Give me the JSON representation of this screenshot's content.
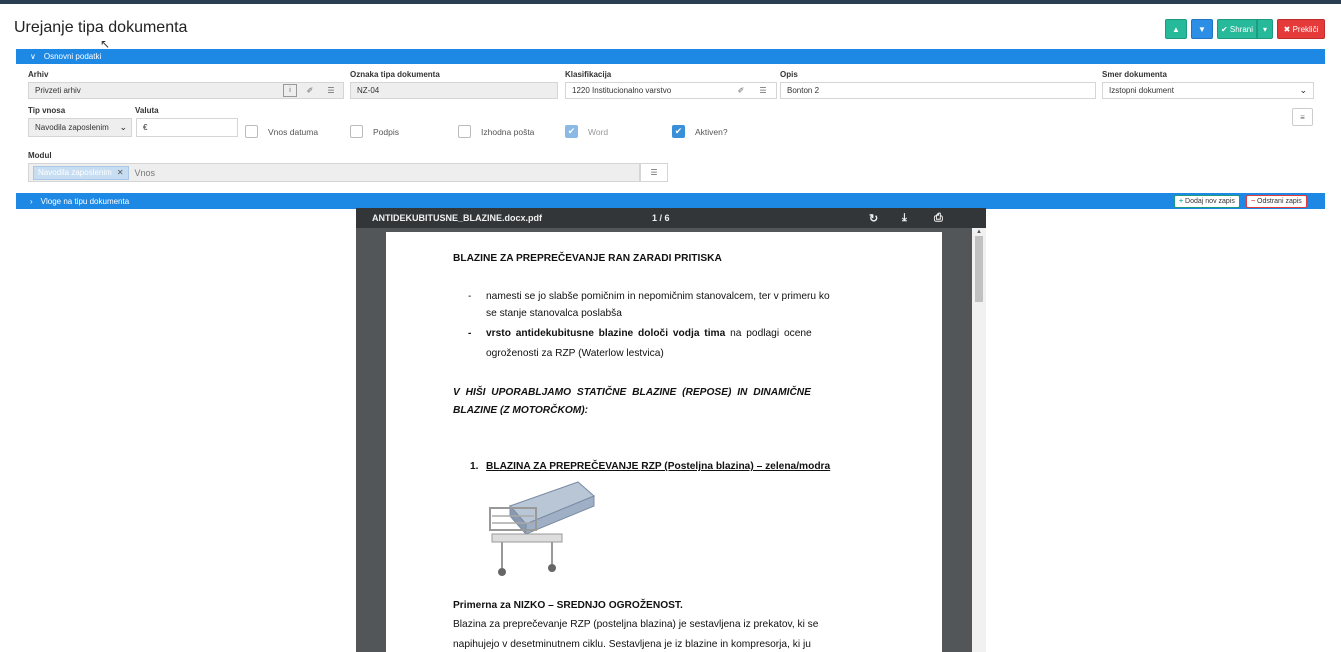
{
  "page": {
    "title": "Urejanje tipa dokumenta",
    "save_label": "Shrani",
    "cancel_label": "Prekliči"
  },
  "section_basic": {
    "label": "Osnovni podatki"
  },
  "section_roles": {
    "label": "Vloge na tipu dokumenta",
    "add_label": "Dodaj nov zapis",
    "remove_label": "Odstrani zapis"
  },
  "fields": {
    "arhiv_label": "Arhiv",
    "arhiv_value": "Privzeti arhiv",
    "oznaka_label": "Oznaka tipa dokumenta",
    "oznaka_value": "NZ-04",
    "klas_label": "Klasifikacija",
    "klas_value": "1220 Institucionalno varstvo",
    "opis_label": "Opis",
    "opis_value": "Bonton 2",
    "smer_label": "Smer dokumenta",
    "smer_value": "Izstopni dokument",
    "tip_label": "Tip vnosa",
    "tip_value": "Navodila zaposlenim",
    "valuta_label": "Valuta",
    "valuta_value": "€",
    "modul_label": "Modul",
    "modul_tag": "Navodila zaposlenim",
    "modul_placeholder": "Vnos"
  },
  "checkboxes": {
    "vnos_datuma": "Vnos datuma",
    "podpis": "Podpis",
    "izhodna_posta": "Izhodna pošta",
    "word": "Word",
    "aktiven": "Aktiven?"
  },
  "viewer": {
    "filename": "ANTIDEKUBITUSNE_BLAZINE.docx.pdf",
    "page_indicator": "1 / 6"
  },
  "doc": {
    "heading": "BLAZINE ZA PREPREČEVANJE RAN ZARADI PRITISKA",
    "bullet1_a": "namesti se jo slabše pomičnim in nepomičnim stanovalcem, ter v primeru ko",
    "bullet1_b": "se stanje stanovalca poslabša",
    "bullet2_bold": "vrsto antidekubitusne blazine določi vodja tima",
    "bullet2_rest": " na podlagi ocene",
    "bullet2_b": "ogroženosti za RZP (Waterlow lestvica)",
    "italic1": "V HIŠI UPORABLJAMO STATIČNE BLAZINE (REPOSE) IN DINAMIČNE",
    "italic2": "BLAZINE (Z MOTORČKOM):",
    "numbered_num": "1.",
    "numbered": "BLAZINA ZA PREPREČEVANJE RZP (Posteljna blazina) – zelena/modra",
    "sub_heading": "Primerna za NIZKO – SREDNJO OGROŽENOST.",
    "para1": "Blazina za preprečevanje RZP (posteljna blazina)  je sestavljena iz prekatov, ki se",
    "para2": "napihujejo v desetminutnem ciklu. Sestavljena je iz blazine in kompresorja, ki ju"
  }
}
